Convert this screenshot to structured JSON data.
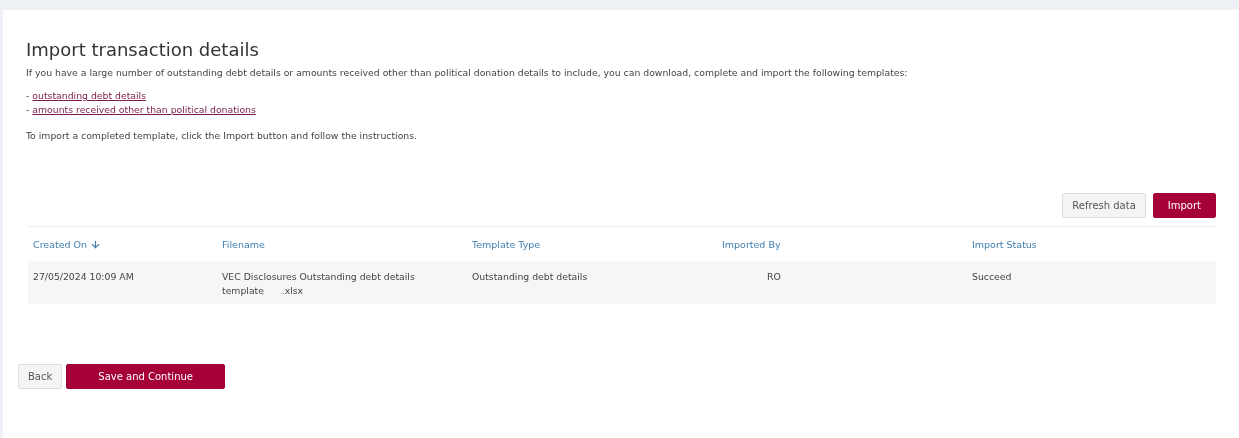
{
  "page": {
    "title": "Import transaction details",
    "intro": "If you have a large number of outstanding debt details or amounts received other than political donation details to include, you can download, complete and import the following templates:",
    "template_links": [
      {
        "prefix": "-",
        "label": "outstanding debt details"
      },
      {
        "prefix": "-",
        "label": "amounts received other than political donations"
      }
    ],
    "instruction": "To import a completed template, click the Import button and follow the instructions."
  },
  "toolbar": {
    "buttons": [
      {
        "label": "Refresh data",
        "kind": "secondary"
      },
      {
        "label": "Import",
        "kind": "primary"
      }
    ]
  },
  "table": {
    "columns": [
      {
        "label": "Created On",
        "sorted": true
      },
      {
        "label": "Filename",
        "sorted": false
      },
      {
        "label": "Template Type",
        "sorted": false
      },
      {
        "label": "Imported By",
        "sorted": false
      },
      {
        "label": "Import Status",
        "sorted": false
      }
    ],
    "rows": [
      [
        "27/05/2024 10:09 AM",
        "VEC Disclosures Outstanding debt details template      .xlsx",
        "Outstanding debt details",
        "RO",
        "Succeed"
      ]
    ]
  },
  "footer": {
    "buttons": [
      {
        "label": "Back",
        "kind": "secondary"
      },
      {
        "label": "Save and Continue",
        "kind": "primary"
      }
    ]
  }
}
